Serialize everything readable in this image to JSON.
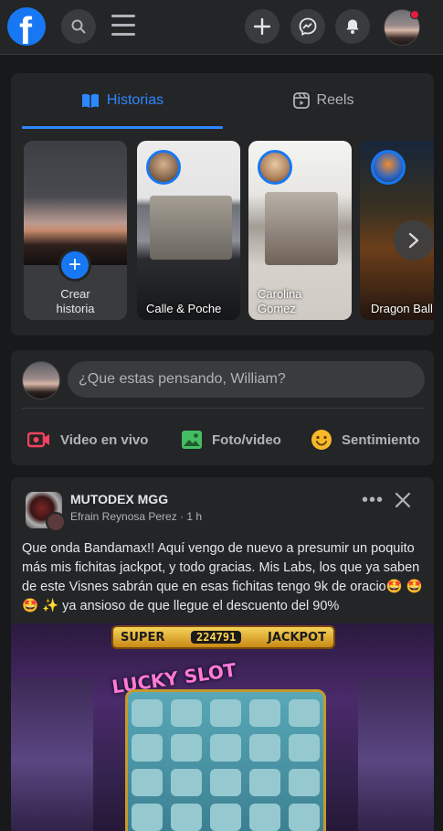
{
  "header": {
    "logo_letter": "f",
    "icons": [
      "facebook-logo",
      "search-icon",
      "menu-icon",
      "plus-icon",
      "messenger-icon",
      "bell-icon",
      "profile-avatar"
    ]
  },
  "stories": {
    "tabs": [
      {
        "label": "Historias",
        "icon": "book-icon",
        "active": true
      },
      {
        "label": "Reels",
        "icon": "reels-icon",
        "active": false
      }
    ],
    "create_label_line1": "Crear",
    "create_label_line2": "historia",
    "items": [
      {
        "label": "Calle & Poche"
      },
      {
        "label_line1": "Carolina",
        "label_line2": "Gomez"
      },
      {
        "label": "Dragon Ball"
      }
    ]
  },
  "composer": {
    "placeholder": "¿Que estas pensando, William?",
    "actions": [
      {
        "label": "Video en vivo",
        "icon": "live-video-icon",
        "color": "#f3425f"
      },
      {
        "label": "Foto/video",
        "icon": "photo-icon",
        "color": "#45bd62"
      },
      {
        "label": "Sentimiento",
        "icon": "feeling-icon",
        "color": "#f7b928"
      }
    ]
  },
  "post": {
    "group": "MUTODEX MGG",
    "author": "Efrain Reynosa Perez",
    "separator": "·",
    "time": "1 h",
    "text": "Que onda Bandamax!! Aquí vengo de nuevo a presumir un poquito más mis fichitas jackpot, y todo gracias. Mis Labs, los que ya saben de este Visnes sabrán que en esas fichitas tengo 9k de oracio🤩 🤩 🤩 ✨ ya ansioso de que llegue el descuento del 90%",
    "image": {
      "banner_left": "SUPER",
      "banner_amount": "224791",
      "banner_right": "JACKPOT",
      "title": "LUCKY SLOT"
    }
  },
  "colors": {
    "accent": "#2d88ff",
    "background": "#18191a",
    "card": "#242526",
    "input": "#3a3b3c"
  }
}
